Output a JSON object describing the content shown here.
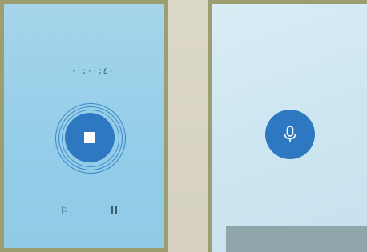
{
  "recorder": {
    "timer": "٠٠:٠٠:٤٠",
    "flag_glyph": "⚐"
  },
  "icons": {
    "stop": "stop-icon",
    "flag": "flag-icon",
    "pause": "pause-icon",
    "mic": "microphone-icon"
  },
  "colors": {
    "accent": "#2e78c1",
    "frame": "#9d9e70",
    "left_panel_bg": "#93cde9",
    "right_panel_bg": "#cde6f1"
  }
}
